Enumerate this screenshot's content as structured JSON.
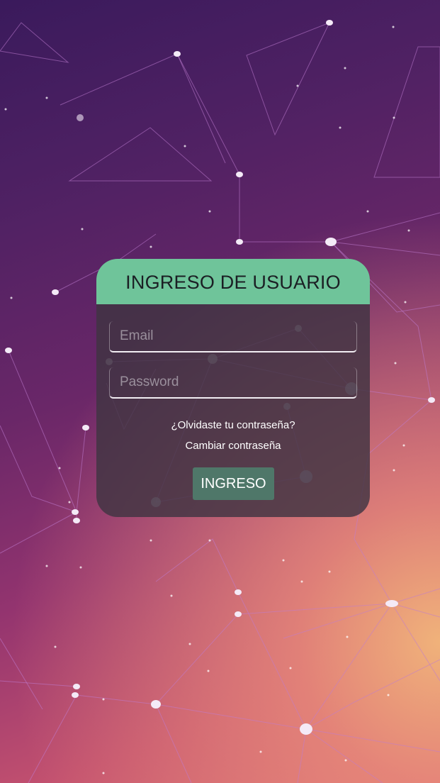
{
  "login": {
    "title": "INGRESO DE USUARIO",
    "email_placeholder": "Email",
    "password_placeholder": "Password",
    "forgot_password_link": "¿Olvidaste tu contraseña?",
    "change_password_link": "Cambiar contraseña",
    "submit_label": "INGRESO"
  },
  "colors": {
    "header_green": "#6fc49a",
    "button_green": "#4f7769",
    "card_background": "#403442",
    "background_top": "#3a1a5c",
    "background_bottom_glow": "#f0b27a"
  }
}
